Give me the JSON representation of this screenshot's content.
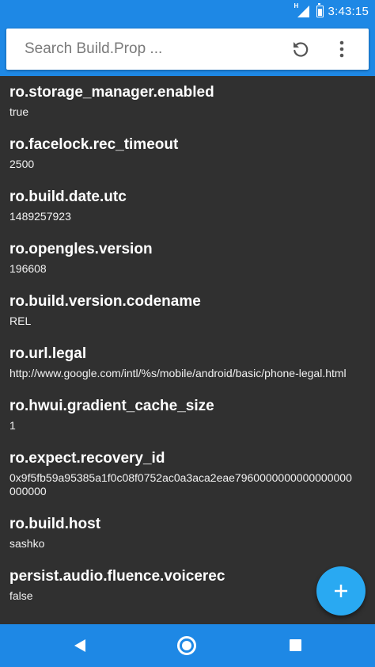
{
  "status_bar": {
    "network_label": "H",
    "time": "3:43:15"
  },
  "search": {
    "placeholder": "Search Build.Prop ..."
  },
  "props": [
    {
      "key": "ro.storage_manager.enabled",
      "value": "true"
    },
    {
      "key": "ro.facelock.rec_timeout",
      "value": "2500"
    },
    {
      "key": "ro.build.date.utc",
      "value": "1489257923"
    },
    {
      "key": "ro.opengles.version",
      "value": "196608"
    },
    {
      "key": "ro.build.version.codename",
      "value": "REL"
    },
    {
      "key": "ro.url.legal",
      "value": "http://www.google.com/intl/%s/mobile/android/basic/phone-legal.html"
    },
    {
      "key": "ro.hwui.gradient_cache_size",
      "value": "1"
    },
    {
      "key": "ro.expect.recovery_id",
      "value": "0x9f5fb59a95385a1f0c08f0752ac0a3aca2eae7960000000000000000000000"
    },
    {
      "key": "ro.build.host",
      "value": "sashko"
    },
    {
      "key": "persist.audio.fluence.voicerec",
      "value": "false"
    }
  ],
  "colors": {
    "primary": "#1e88e5",
    "fab": "#29a9f2",
    "background": "#303030"
  }
}
